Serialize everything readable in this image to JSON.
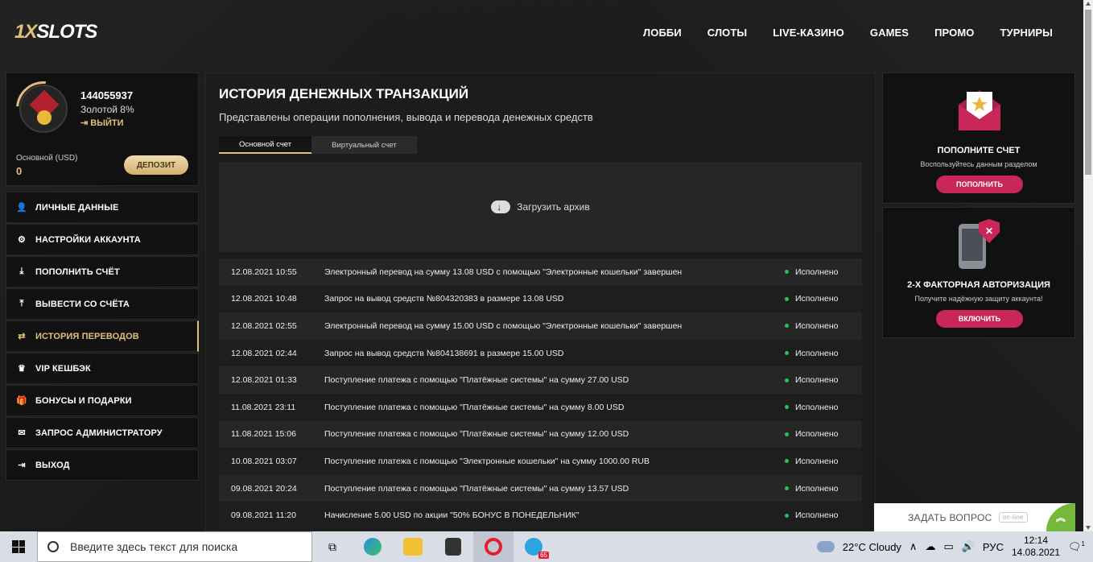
{
  "header": {
    "logo_prefix": "1X",
    "logo_rest": "SLOTS",
    "nav": [
      "ЛОББИ",
      "СЛОТЫ",
      "LIVE-КАЗИНО",
      "GAMES",
      "ПРОМО",
      "ТУРНИРЫ"
    ]
  },
  "profile": {
    "id": "144055937",
    "level": "Золотой 8%",
    "logout": "ВЫЙТИ",
    "balance_label": "Основной (USD)",
    "balance_value": "0",
    "deposit_button": "ДЕПОЗИТ"
  },
  "menu": [
    {
      "label": "ЛИЧНЫЕ ДАННЫЕ",
      "icon": "user-add-icon",
      "glyph": "👤"
    },
    {
      "label": "НАСТРОЙКИ АККАУНТА",
      "icon": "gears-icon",
      "glyph": "⚙"
    },
    {
      "label": "ПОПОЛНИТЬ СЧЁТ",
      "icon": "download-icon",
      "glyph": "⤓"
    },
    {
      "label": "ВЫВЕСТИ СО СЧЁТА",
      "icon": "upload-icon",
      "glyph": "⤒"
    },
    {
      "label": "ИСТОРИЯ ПЕРЕВОДОВ",
      "icon": "transfer-arrows-icon",
      "glyph": "⇄"
    },
    {
      "label": "VIP КЕШБЭК",
      "icon": "crown-icon",
      "glyph": "♛"
    },
    {
      "label": "БОНУСЫ И ПОДАРКИ",
      "icon": "gift-icon",
      "glyph": "🎁"
    },
    {
      "label": "ЗАПРОС АДМИНИСТРАТОРУ",
      "icon": "mail-icon",
      "glyph": "✉"
    },
    {
      "label": "ВЫХОД",
      "icon": "exit-icon",
      "glyph": "⇥"
    }
  ],
  "main": {
    "title": "ИСТОРИЯ ДЕНЕЖНЫХ ТРАНЗАКЦИЙ",
    "subtitle": "Представлены операции пополнения, вывода и перевода денежных средств",
    "tabs": [
      "Основной счет",
      "Виртуальный счет"
    ],
    "archive_label": "Загрузить архив",
    "transactions": [
      {
        "date": "12.08.2021 10:55",
        "text": "Электронный перевод на сумму 13.08 USD с помощью \"Электронные кошельки\" завершен",
        "status": "Исполнено"
      },
      {
        "date": "12.08.2021 10:48",
        "text": "Запрос на вывод средств №804320383 в размере 13.08 USD",
        "status": "Исполнено"
      },
      {
        "date": "12.08.2021 02:55",
        "text": "Электронный перевод на сумму 15.00 USD с помощью \"Электронные кошельки\" завершен",
        "status": "Исполнено"
      },
      {
        "date": "12.08.2021 02:44",
        "text": "Запрос на вывод средств №804138691 в размере 15.00 USD",
        "status": "Исполнено"
      },
      {
        "date": "12.08.2021 01:33",
        "text": "Поступление платежа с помощью \"Платёжные системы\" на сумму 27.00 USD",
        "status": "Исполнено"
      },
      {
        "date": "11.08.2021 23:11",
        "text": "Поступление платежа с помощью \"Платёжные системы\" на сумму 8.00 USD",
        "status": "Исполнено"
      },
      {
        "date": "11.08.2021 15:06",
        "text": "Поступление платежа с помощью \"Платёжные системы\" на сумму 12.00 USD",
        "status": "Исполнено"
      },
      {
        "date": "10.08.2021 03:07",
        "text": "Поступление платежа с помощью \"Электронные кошельки\" на сумму 1000.00 RUB",
        "status": "Исполнено"
      },
      {
        "date": "09.08.2021 20:24",
        "text": "Поступление платежа с помощью \"Платёжные системы\" на сумму 13.57 USD",
        "status": "Исполнено"
      },
      {
        "date": "09.08.2021 11:20",
        "text": "Начисление 5.00 USD по акции \"50% БОНУС В ПОНЕДЕЛЬНИК\"",
        "status": "Исполнено"
      }
    ]
  },
  "right": {
    "card1": {
      "title": "ПОПОЛНИТЕ СЧЕТ",
      "sub": "Воспользуйтесь данным разделом",
      "button": "ПОПОЛНИТЬ"
    },
    "card2": {
      "title": "2-Х ФАКТОРНАЯ АВТОРИЗАЦИЯ",
      "sub": "Получите надёжную защиту аккаунта!",
      "button": "ВКЛЮЧИТЬ"
    }
  },
  "chat": {
    "label": "ЗАДАТЬ ВОПРОС",
    "status": "on-line"
  },
  "taskbar": {
    "search_placeholder": "Введите здесь текст для поиска",
    "weather": "22°C  Cloudy",
    "lang": "РУС",
    "time": "12:14",
    "date": "14.08.2021",
    "opera_badge": "65",
    "notif_count": "1"
  },
  "colors": {
    "gold": "#e2c07a",
    "accent_pink": "#c9265a",
    "status_green": "#22c45e"
  }
}
